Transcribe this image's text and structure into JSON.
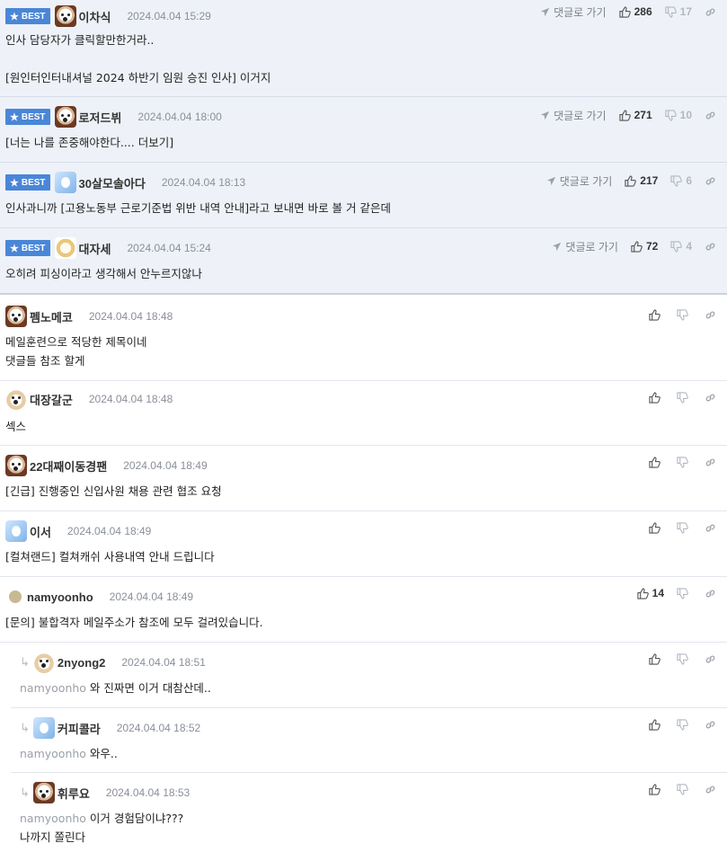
{
  "labels": {
    "best": "BEST",
    "reply_go": "댓글로 가기"
  },
  "best_comments": [
    {
      "nick": "이차식",
      "date": "2024.04.04 15:29",
      "likes": "286",
      "dislikes": "17",
      "body": "인사 담당자가 클릭할만한거라..\n\n[원인터인터내셔널 2024 하반기 임원 승진 인사] 이거지",
      "avatar": "dog-icon"
    },
    {
      "nick": "로저드뷔",
      "date": "2024.04.04 18:00",
      "likes": "271",
      "dislikes": "10",
      "body": "[너는 나를 존중해야한다.... 더보기]",
      "avatar": "dog-icon"
    },
    {
      "nick": "30살모솔아다",
      "date": "2024.04.04 18:13",
      "likes": "217",
      "dislikes": "6",
      "body": "인사과니까 [고용노동부 근로기준법 위반 내역 안내]라고 보내면 바로 볼 거 같은데",
      "avatar": "blue-character-icon"
    },
    {
      "nick": "대자세",
      "date": "2024.04.04 15:24",
      "likes": "72",
      "dislikes": "4",
      "body": "오히려 피싱이라고 생각해서 안누르지않나",
      "avatar": "cat-icon"
    }
  ],
  "comments": [
    {
      "nick": "펨노메코",
      "date": "2024.04.04 18:48",
      "likes": "",
      "body": "메일훈련으로 적당한 제목이네\n댓글들 참조 할게"
    },
    {
      "nick": "대장갈군",
      "date": "2024.04.04 18:48",
      "likes": "",
      "body": "섹스"
    },
    {
      "nick": "22대째이동경팬",
      "date": "2024.04.04 18:49",
      "likes": "",
      "body": "[긴급] 진행중인 신입사원 채용 관련 협조 요청"
    },
    {
      "nick": "이서",
      "date": "2024.04.04 18:49",
      "likes": "",
      "body": "[컬쳐랜드] 컬쳐캐쉬 사용내역 안내 드립니다"
    },
    {
      "nick": "namyoonho",
      "date": "2024.04.04 18:49",
      "likes": "14",
      "body": "[문의] 불합격자 메일주소가 참조에 모두 걸려있습니다."
    }
  ],
  "replies": [
    {
      "nick": "2nyong2",
      "date": "2024.04.04 18:51",
      "mention": "namyoonho",
      "body": " 와 진짜면 이거 대참산데.."
    },
    {
      "nick": "커피콜라",
      "date": "2024.04.04 18:52",
      "mention": "namyoonho",
      "body": " 와우.."
    },
    {
      "nick": "휘루요",
      "date": "2024.04.04 18:53",
      "mention": "namyoonho",
      "body": " 이거 경험담이냐???",
      "body2": "나까지 쫄린다"
    }
  ],
  "colors": {
    "accent": "#4a86d8",
    "best_bg": "#eef2f8"
  }
}
